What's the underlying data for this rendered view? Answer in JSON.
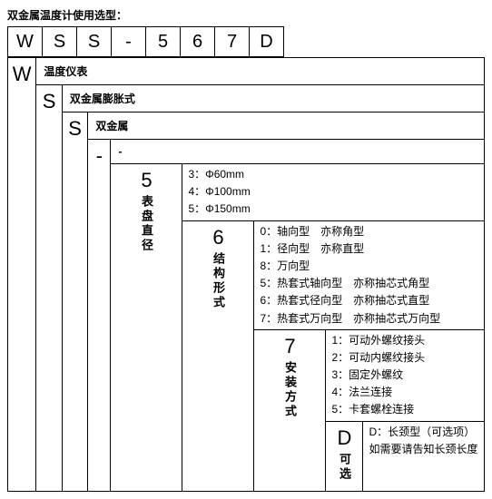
{
  "title": "双金属温度计使用选型：",
  "code": {
    "c0": "W",
    "c1": "S",
    "c2": "S",
    "c3": "-",
    "c4": "5",
    "c5": "6",
    "c6": "7",
    "c7": "D"
  },
  "L1": {
    "char": "W",
    "label": "",
    "desc": "温度仪表"
  },
  "L2": {
    "char": "S",
    "label": "",
    "desc": "双金属膨胀式"
  },
  "L3": {
    "char": "S",
    "label": "",
    "desc": "双金属"
  },
  "L4": {
    "char": "-",
    "label": "",
    "desc": "-"
  },
  "L5": {
    "char": "5",
    "label": "表盘直径",
    "opts": {
      "o0": "3：Φ60mm",
      "o1": "4：Φ100mm",
      "o2": "5：Φ150mm"
    }
  },
  "L6": {
    "char": "6",
    "label": "结构形式",
    "opts": {
      "o0": "0：轴向型 亦称角型",
      "o1": "1：径向型 亦称直型",
      "o2": "8：万向型",
      "o3": "5：热套式轴向型 亦称抽芯式角型",
      "o4": "6：热套式径向型 亦称抽芯式直型",
      "o5": "7：热套式万向型 亦称抽芯式万向型"
    }
  },
  "L7": {
    "char": "7",
    "label": "安装方式",
    "opts": {
      "o0": "1：可动外螺纹接头",
      "o1": "2：可动内螺纹接头",
      "o2": "3：固定外螺纹",
      "o3": "4：法兰连接",
      "o4": "5：卡套螺栓连接"
    }
  },
  "L8": {
    "char": "D",
    "label": "可选",
    "opts": {
      "o0": "D：长颈型（可选项）如需要请告知长颈长度"
    }
  }
}
